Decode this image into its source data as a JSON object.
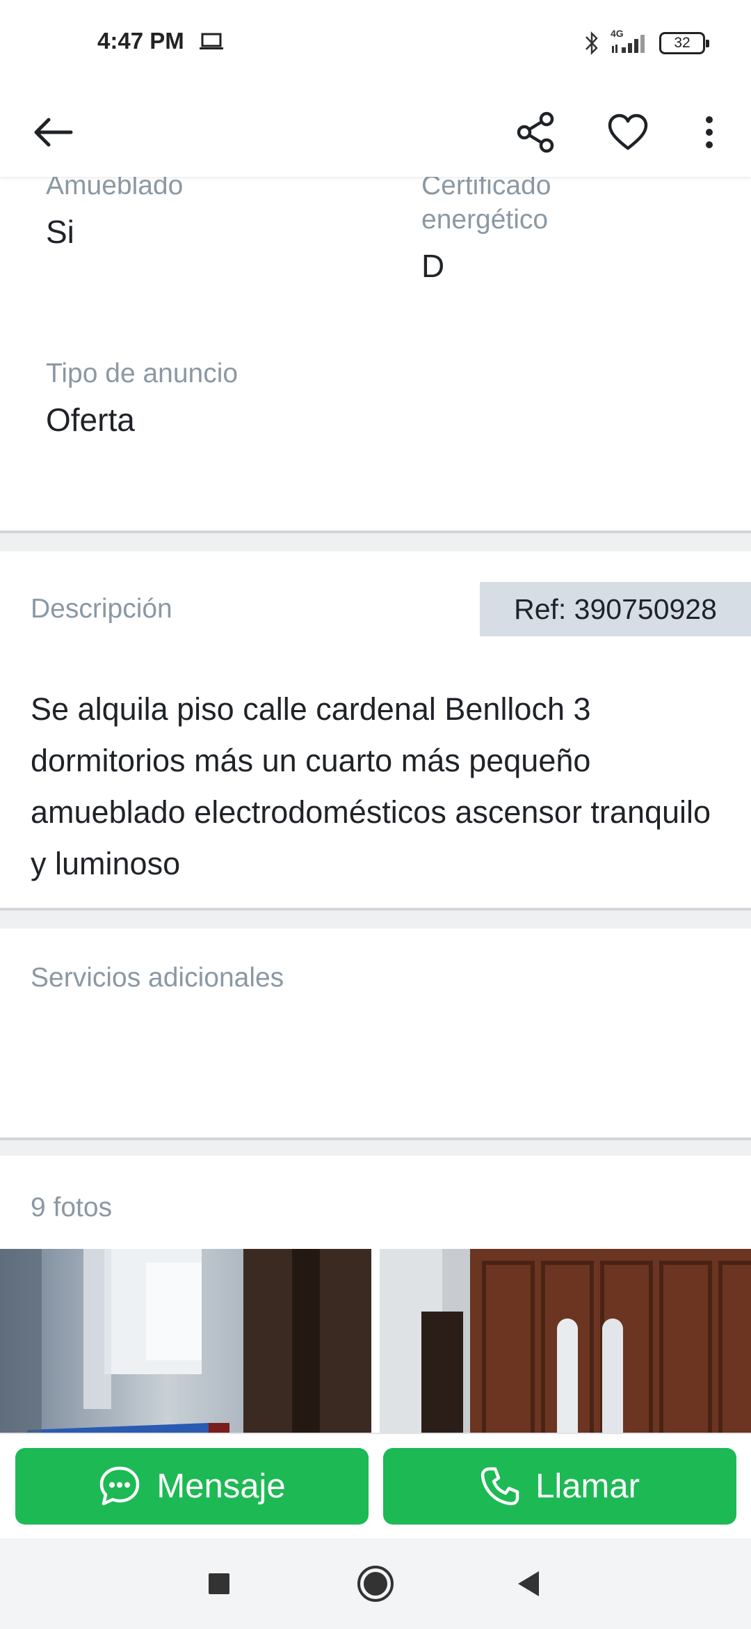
{
  "status_bar": {
    "time": "4:47 PM",
    "network": "4G",
    "battery": "32"
  },
  "app_bar": {
    "back_icon": "arrow-left-icon",
    "share_icon": "share-icon",
    "favorite_icon": "heart-outline-icon",
    "more_icon": "more-vertical-icon"
  },
  "features": [
    {
      "label": "Amueblado",
      "value": "Si"
    },
    {
      "label": "Certificado energético",
      "value": "D"
    },
    {
      "label": "Tipo de anuncio",
      "value": "Oferta"
    }
  ],
  "description": {
    "title": "Descripción",
    "ref": "Ref: 390750928",
    "text": "Se alquila piso calle cardenal Benlloch 3 dormitorios más un cuarto más pequeño amueblado  electrodomésticos  ascensor tranquilo y luminoso"
  },
  "services": {
    "title": "Servicios adicionales"
  },
  "photos": {
    "count_label": "9 fotos"
  },
  "actions": {
    "message_label": "Mensaje",
    "call_label": "Llamar"
  },
  "colors": {
    "accent": "#1db954",
    "label_gray": "#8b98a3",
    "text": "#1f2328",
    "ref_bg": "#d6dde4"
  }
}
